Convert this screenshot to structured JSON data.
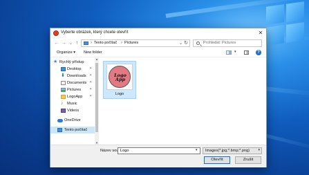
{
  "dialog": {
    "title": "Vyberte obrázek, který chcete otevřít",
    "close_glyph": "✕"
  },
  "address": {
    "back_glyph": "←",
    "forward_glyph": "→",
    "recent_glyph": "⌄",
    "up_glyph": "↑",
    "crumbs": [
      "Tento počítač",
      "Pictures"
    ],
    "separator": "›",
    "dropdown_glyph": "⌄",
    "refresh_glyph": "↻"
  },
  "search": {
    "placeholder": "Prohledat: Pictures"
  },
  "toolbar": {
    "organize_label": "Organize ▾",
    "new_folder_label": "New folder",
    "view_dropdown_glyph": "▾",
    "help_glyph": "?"
  },
  "nav": {
    "items": [
      {
        "label": "Rychlý přístup",
        "icon": "star-icon",
        "pinned": false,
        "selected": false
      },
      {
        "label": "Desktop",
        "icon": "desktop-icon",
        "pinned": true,
        "selected": false
      },
      {
        "label": "Downloads",
        "icon": "download-icon",
        "pinned": true,
        "selected": false
      },
      {
        "label": "Documents",
        "icon": "documents-icon",
        "pinned": true,
        "selected": false
      },
      {
        "label": "Pictures",
        "icon": "pictures-icon",
        "pinned": true,
        "selected": false
      },
      {
        "label": "LogoApp",
        "icon": "folder-icon",
        "pinned": true,
        "selected": false
      },
      {
        "label": "Music",
        "icon": "music-icon",
        "pinned": false,
        "selected": false
      },
      {
        "label": "Videos",
        "icon": "videos-icon",
        "pinned": false,
        "selected": false
      },
      {
        "label": "OneDrive",
        "icon": "cloud-icon",
        "pinned": false,
        "selected": false
      },
      {
        "label": "Tento počítač",
        "icon": "computer-icon",
        "pinned": false,
        "selected": true
      }
    ],
    "pin_glyph": "📌"
  },
  "files": [
    {
      "name": "Logo",
      "thumbnail_text": "Logo App"
    }
  ],
  "bottom": {
    "filename_label": "Název souboru:",
    "filename_value": "Logo",
    "filetype_value": "Images(*.jpg;*.bmp;*.png)",
    "dropdown_glyph": "▾",
    "open_label": "Otevřít",
    "cancel_label": "Zrušit"
  },
  "colors": {
    "accent": "#0078d7",
    "selection": "#cce8ff",
    "logo_circle": "#e37a83"
  }
}
